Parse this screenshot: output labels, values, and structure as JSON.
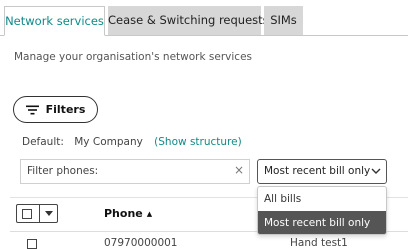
{
  "tabs": [
    {
      "label": "Network services",
      "active": true
    },
    {
      "label": "Cease & Switching requests",
      "active": false
    },
    {
      "label": "SIMs",
      "active": false
    }
  ],
  "subtitle": "Manage your organisation's network services",
  "filters_button": {
    "label": "Filters",
    "icon": "filter-lines-icon"
  },
  "default_row": {
    "label": "Default:",
    "company": "My Company",
    "structure_link": "(Show structure)"
  },
  "filter_phones": {
    "placeholder": "Filter phones:",
    "clear_icon": "×"
  },
  "bill_select": {
    "value": "Most recent bill only",
    "options": [
      {
        "label": "All bills",
        "selected": false
      },
      {
        "label": "Most recent bill only",
        "selected": true
      }
    ]
  },
  "table": {
    "columns": {
      "phone": "Phone"
    },
    "rows": [
      {
        "phone": "07970000001",
        "name": "Hand test1"
      }
    ]
  },
  "colors": {
    "accent": "#0e8a8a",
    "tab_inactive": "#d7d7d7",
    "selected_option": "#555555"
  }
}
